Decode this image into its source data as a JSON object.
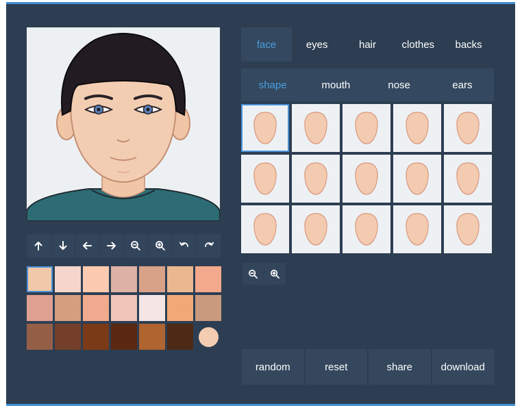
{
  "tabs": [
    {
      "label": "face",
      "active": true
    },
    {
      "label": "eyes",
      "active": false
    },
    {
      "label": "hair",
      "active": false
    },
    {
      "label": "clothes",
      "active": false
    },
    {
      "label": "backs",
      "active": false
    }
  ],
  "subtabs": [
    {
      "label": "shape",
      "active": true
    },
    {
      "label": "mouth",
      "active": false
    },
    {
      "label": "nose",
      "active": false
    },
    {
      "label": "ears",
      "active": false
    }
  ],
  "toolbar": [
    {
      "name": "move-up-button",
      "icon": "arrow-up-icon"
    },
    {
      "name": "move-down-button",
      "icon": "arrow-down-icon"
    },
    {
      "name": "move-left-button",
      "icon": "arrow-left-icon"
    },
    {
      "name": "move-right-button",
      "icon": "arrow-right-icon"
    },
    {
      "name": "zoom-out-button",
      "icon": "zoom-out-icon"
    },
    {
      "name": "zoom-in-button",
      "icon": "zoom-in-icon"
    },
    {
      "name": "undo-button",
      "icon": "undo-icon"
    },
    {
      "name": "redo-button",
      "icon": "redo-icon"
    }
  ],
  "skin_colors": [
    "#f0c9a8",
    "#f5d5cc",
    "#fbcab0",
    "#ddb1a4",
    "#d8a289",
    "#eab88f",
    "#f3a98b",
    "#dfa092",
    "#d59e7f",
    "#f0aa8e",
    "#efc6b9",
    "#f5e5e4",
    "#f2a976",
    "#c99a7e",
    "#955e47",
    "#733f2a",
    "#7a3a17",
    "#5b2812",
    "#b0642f",
    "#4d2a15",
    "#f3cdb2"
  ],
  "selected_color_index": 0,
  "face_shapes_count": 15,
  "selected_shape_index": 0,
  "face_color": "#f3cbb0",
  "face_outline": "#d9977e",
  "zoom_buttons": [
    {
      "name": "shape-zoom-out-button",
      "icon": "zoom-out-icon"
    },
    {
      "name": "shape-zoom-in-button",
      "icon": "zoom-in-icon"
    }
  ],
  "actions": [
    {
      "label": "random"
    },
    {
      "label": "reset"
    },
    {
      "label": "share"
    },
    {
      "label": "download"
    }
  ]
}
